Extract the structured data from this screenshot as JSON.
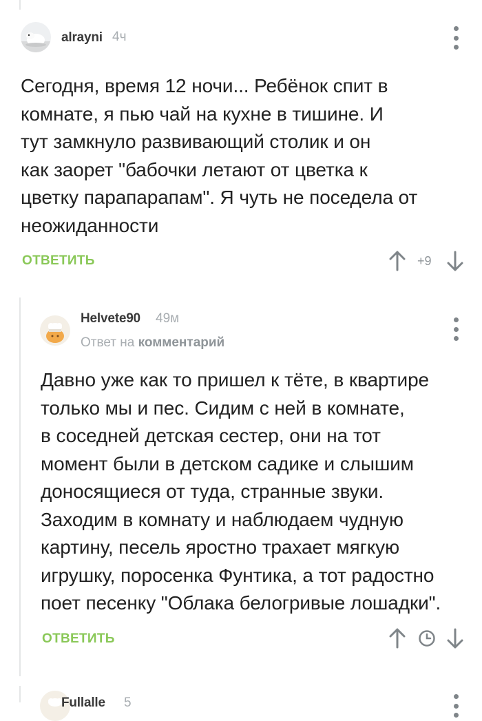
{
  "comments": [
    {
      "username": "alrayni",
      "time": "4ч",
      "text": "Сегодня, время 12 ночи... Ребёнок спит в\nкомнате, я пью чай на кухне в тишине. И\nтут замкнуло развивающий столик и он\nкак заорет \"бабочки летают от цветка к\nцветку парапарапам\". Я чуть не поседела от\nнеожиданности",
      "reply_label": "ОТВЕТИТЬ",
      "score": "+9",
      "icons": [
        "upvote-arrow-icon",
        "downvote-arrow-icon",
        "more-options-icon"
      ]
    },
    {
      "username": "Helvete90",
      "time": "49м",
      "reply_to_prefix": "Ответ на",
      "reply_to_target": "комментарий",
      "text": "Давно уже как то пришел к тёте, в квартире\nтолько мы и пес. Сидим с ней в комнате,\nв соседней детская сестер, они на тот\nмомент были в детском садике и слышим\nдоносящиеся от туда, странные звуки.\nЗаходим в комнату и наблюдаем чудную\nкартину, песель яростно трахает мягкую\nигрушку, поросенка Фунтика, а тот радостно\nпоет песенку \"Облака белогривые лошадки\".",
      "reply_label": "ОТВЕТИТЬ",
      "icons": [
        "upvote-arrow-icon",
        "clock-icon",
        "downvote-arrow-icon",
        "more-options-icon"
      ]
    },
    {
      "username": "Fullalle",
      "time": "5"
    }
  ],
  "colors": {
    "reply": "#8ac858",
    "username": "#3a3a3a",
    "meta": "#a8adb1",
    "icon": "#7f8589",
    "thread_line": "#e4e6e7"
  }
}
